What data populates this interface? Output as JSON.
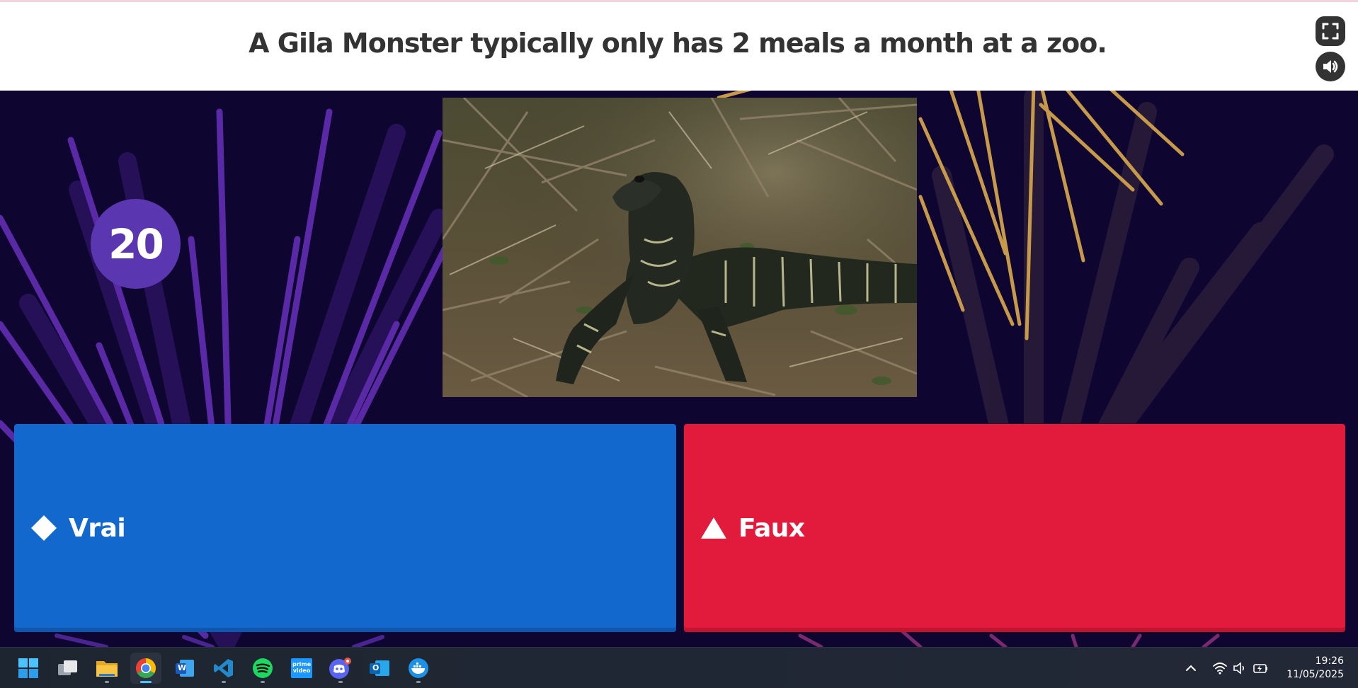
{
  "quiz": {
    "question": "A Gila Monster typically only has 2 meals a month at a zoo.",
    "timer": "20",
    "image_alt": "lizard-photo",
    "answers": [
      {
        "label": "Vrai",
        "shape": "diamond",
        "color": "#1368ce"
      },
      {
        "label": "Faux",
        "shape": "triangle",
        "color": "#e21b3c"
      }
    ]
  },
  "header": {
    "buttons": [
      {
        "name": "fullscreen",
        "icon": "fullscreen-icon"
      },
      {
        "name": "sound",
        "icon": "speaker-icon"
      }
    ]
  },
  "taskbar": {
    "apps": [
      {
        "name": "start",
        "icon": "windows-start-icon"
      },
      {
        "name": "task-view",
        "icon": "task-view-icon"
      },
      {
        "name": "file-explorer",
        "icon": "folder-icon"
      },
      {
        "name": "chrome",
        "icon": "chrome-icon",
        "active": true
      },
      {
        "name": "word",
        "icon": "word-icon",
        "label": "W"
      },
      {
        "name": "vscode",
        "icon": "vscode-icon"
      },
      {
        "name": "spotify",
        "icon": "spotify-icon"
      },
      {
        "name": "prime-video",
        "icon": "prime-video-icon",
        "label": "prime video"
      },
      {
        "name": "discord",
        "icon": "discord-icon"
      },
      {
        "name": "outlook",
        "icon": "outlook-icon",
        "label": "O"
      },
      {
        "name": "docker",
        "icon": "docker-icon"
      }
    ],
    "tray": {
      "icons": [
        "chevron-up-icon",
        "wifi-icon",
        "volume-icon",
        "battery-icon"
      ],
      "time": "19:26",
      "date": "11/05/2025"
    }
  }
}
